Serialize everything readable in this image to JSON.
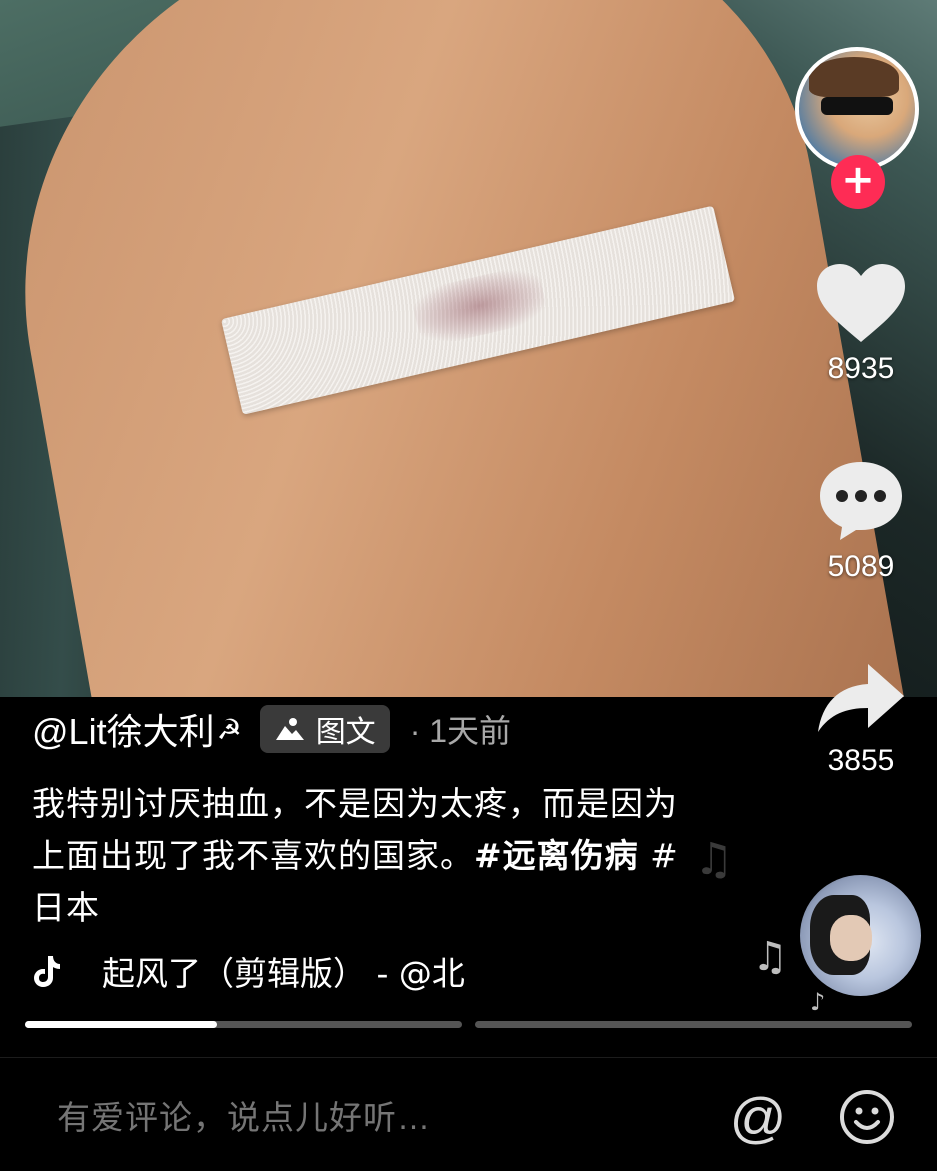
{
  "post": {
    "author": "@Lit徐大利",
    "author_symbol": "☭",
    "type_badge": "图文",
    "time": "· 1天前",
    "description": "我特别讨厌抽血，不是因为太疼，而是因为上面出现了我不喜欢的国家。",
    "hashtags": [
      "#远离伤病",
      "#日本"
    ],
    "music": "起风了（剪辑版） - @北"
  },
  "actions": {
    "likes": "8935",
    "comments": "5089",
    "shares": "3855"
  },
  "progress": [
    0.44,
    0.0
  ],
  "comment_bar": {
    "placeholder": "有爱评论，说点儿好听…",
    "at_label": "@"
  },
  "icons": {
    "follow": "plus-icon",
    "like": "heart-icon",
    "comment": "comment-bubble-icon",
    "share": "share-arrow-icon",
    "music": "tiktok-note-icon",
    "emoji": "smiley-icon",
    "image_post": "image-icon"
  },
  "colors": {
    "accent": "#fe2c55",
    "background": "#000000",
    "muted_text": "#a8a8a8"
  }
}
